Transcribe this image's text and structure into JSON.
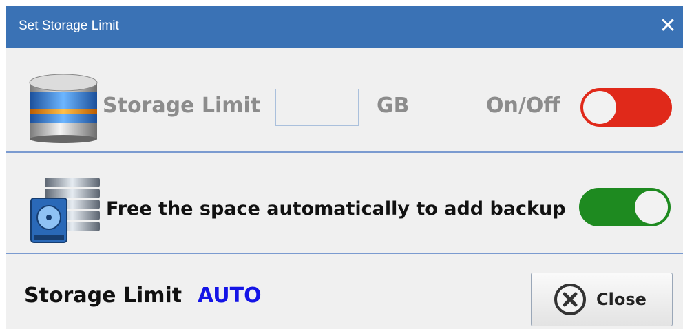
{
  "window": {
    "title": "Set Storage Limit",
    "close_glyph": "✕"
  },
  "storage_row": {
    "label": "Storage Limit",
    "value": "",
    "unit": "GB",
    "toggle_label": "On/Off",
    "toggle_on": false,
    "icon": "database-icon"
  },
  "auto_row": {
    "label": "Free the space automatically to add backup",
    "toggle_on": true,
    "icon": "server-drive-icon"
  },
  "footer": {
    "label": "Storage Limit",
    "value": "AUTO",
    "value_color": "#1414e6",
    "close_label": "Close",
    "close_icon": "close-circle-icon"
  },
  "colors": {
    "titlebar": "#3a72b5",
    "toggle_off": "#e0291a",
    "toggle_on": "#1e8a20"
  }
}
